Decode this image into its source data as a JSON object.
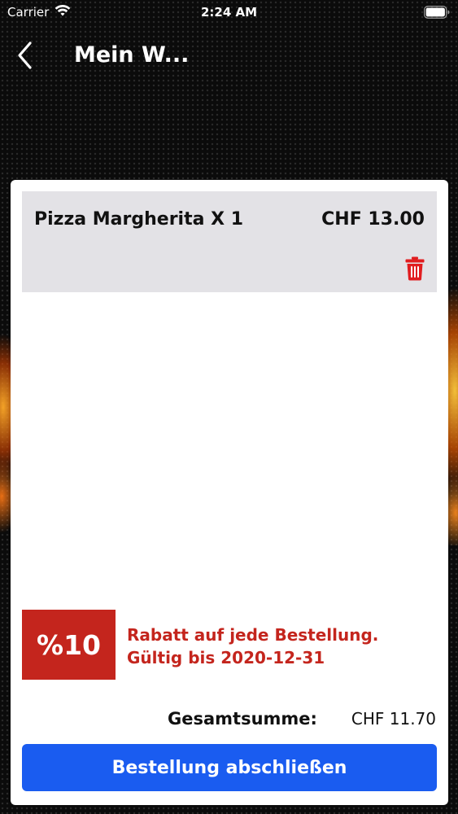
{
  "status_bar": {
    "carrier": "Carrier",
    "time": "2:24 AM",
    "wifi_icon": "wifi-icon",
    "battery_icon": "battery-icon"
  },
  "nav": {
    "back_icon": "chevron-left-icon",
    "title": "Mein W..."
  },
  "cart": {
    "items": [
      {
        "name": "Pizza Margherita X 1",
        "price": "CHF 13.00",
        "delete_icon": "trash-icon"
      }
    ]
  },
  "discount": {
    "badge": "%10",
    "line1": "Rabatt auf jede Bestellung.",
    "line2": "Gültig bis 2020-12-31"
  },
  "total": {
    "label": "Gesamtsumme:",
    "value": "CHF 11.70"
  },
  "checkout_button": "Bestellung abschließen",
  "colors": {
    "accent_blue": "#1a5cf0",
    "discount_red": "#c4251d",
    "item_bg": "#e3e2e6"
  }
}
